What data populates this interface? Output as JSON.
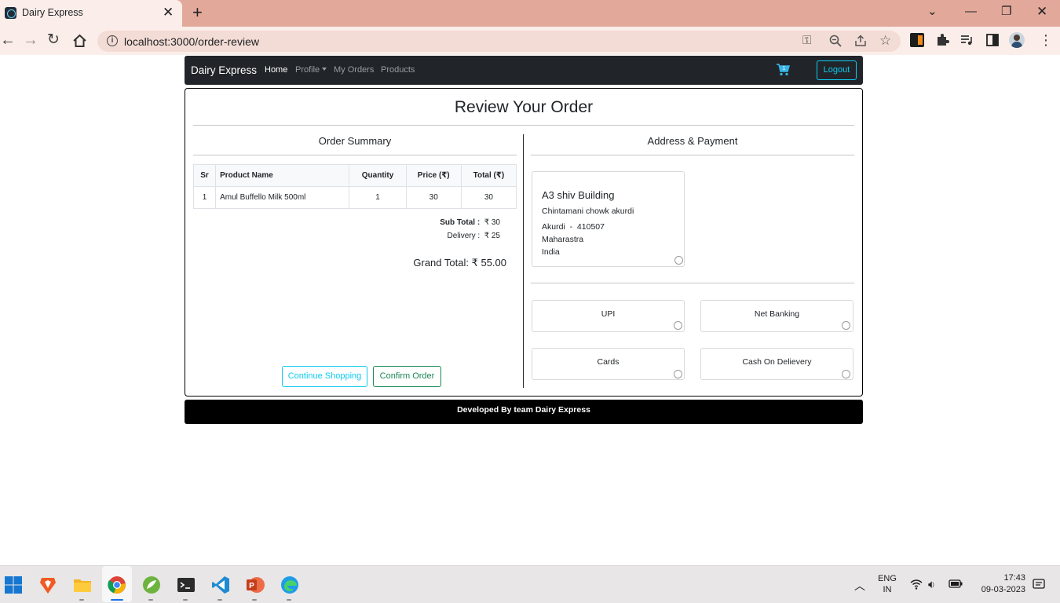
{
  "browser": {
    "tab_title": "Dairy Express",
    "url": "localhost:3000/order-review"
  },
  "navbar": {
    "brand": "Dairy Express",
    "links": [
      "Home",
      "Profile",
      "My Orders",
      "Products"
    ],
    "cart_count": "1",
    "logout_label": "Logout"
  },
  "page": {
    "title": "Review Your Order",
    "order_summary_title": "Order Summary",
    "address_payment_title": "Address & Payment"
  },
  "order_table": {
    "columns": [
      "Sr",
      "Product Name",
      "Quantity",
      "Price (₹)",
      "Total (₹)"
    ],
    "rows": [
      [
        "1",
        "Amul Buffello Milk 500ml",
        "1",
        "30",
        "30"
      ]
    ]
  },
  "totals": {
    "sub_total_label": "Sub Total :",
    "sub_total_value": "₹ 30",
    "delivery_label": "Delivery :",
    "delivery_value": "₹ 25",
    "grand_total": "Grand Total: ₹ 55.00"
  },
  "buttons": {
    "continue_shopping": "Continue Shopping",
    "confirm_order": "Confirm Order"
  },
  "address": {
    "building": "A3 shiv Building",
    "street": "Chintamani chowk akurdi",
    "city_pin": "Akurdi  -  410507",
    "state": "Maharastra",
    "country": "India"
  },
  "payment_methods": [
    "UPI",
    "Net Banking",
    "Cards",
    "Cash On Delievery"
  ],
  "footer": {
    "text": "Developed By team Dairy Express"
  },
  "taskbar": {
    "lang_line1": "ENG",
    "lang_line2": "IN",
    "time": "17:43",
    "date": "09-03-2023"
  },
  "colors": {
    "tabstrip": "#e2a99a",
    "navbar": "#212529",
    "info": "#0dcaf0",
    "success": "#198754",
    "footer": "#000000"
  }
}
